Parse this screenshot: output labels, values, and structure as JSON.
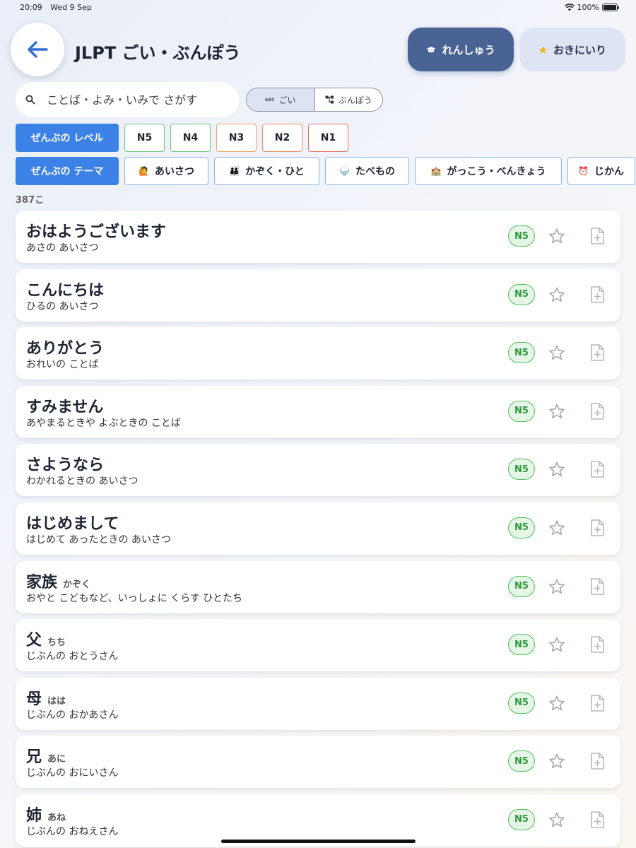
{
  "status_bar": {
    "time": "20:09",
    "date": "Wed 9 Sep",
    "battery": "100%"
  },
  "header": {
    "title": "JLPT ごい・ぶんぽう",
    "practice_label": "れんしゅう",
    "favorites_label": "おきにいり"
  },
  "search": {
    "placeholder": "ことば・よみ・いみで さがす",
    "value": ""
  },
  "segment": {
    "vocab_label": "ごい",
    "grammar_label": "ぶんぽう",
    "selected": "ごい"
  },
  "levels": {
    "all_label": "ぜんぶの レベル",
    "items": [
      "N5",
      "N4",
      "N3",
      "N2",
      "N1"
    ]
  },
  "themes": {
    "all_label": "ぜんぶの テーマ",
    "items": [
      {
        "label": "あいさつ",
        "icon": "🙋"
      },
      {
        "label": "かぞく・ひと",
        "icon": "👪"
      },
      {
        "label": "たべもの",
        "icon": "🍚"
      },
      {
        "label": "がっこう・べんきょう",
        "icon": "🏫"
      },
      {
        "label": "じかん",
        "icon": "⏰"
      }
    ]
  },
  "result_count": "387こ",
  "entries": [
    {
      "word": "おはようございます",
      "reading": "",
      "meaning": "あさの あいさつ",
      "level": "N5"
    },
    {
      "word": "こんにちは",
      "reading": "",
      "meaning": "ひるの あいさつ",
      "level": "N5"
    },
    {
      "word": "ありがとう",
      "reading": "",
      "meaning": "おれいの ことば",
      "level": "N5"
    },
    {
      "word": "すみません",
      "reading": "",
      "meaning": "あやまるときや よぶときの ことば",
      "level": "N5"
    },
    {
      "word": "さようなら",
      "reading": "",
      "meaning": "わかれるときの あいさつ",
      "level": "N5"
    },
    {
      "word": "はじめまして",
      "reading": "",
      "meaning": "はじめて あったときの あいさつ",
      "level": "N5"
    },
    {
      "word": "家族",
      "reading": "かぞく",
      "meaning": "おやと こどもなど、いっしょに くらす ひとたち",
      "level": "N5"
    },
    {
      "word": "父",
      "reading": "ちち",
      "meaning": "じぶんの おとうさん",
      "level": "N5"
    },
    {
      "word": "母",
      "reading": "はは",
      "meaning": "じぶんの おかあさん",
      "level": "N5"
    },
    {
      "word": "兄",
      "reading": "あに",
      "meaning": "じぶんの おにいさん",
      "level": "N5"
    },
    {
      "word": "姉",
      "reading": "あね",
      "meaning": "じぶんの おねえさん",
      "level": "N5"
    }
  ],
  "colors": {
    "primary": "#3c82e6",
    "practice_bg": "#4a6395",
    "favorites_bg": "#dfe4f4",
    "badge_green": "#4fbf5b",
    "level_borders": {
      "N5": "#6cc477",
      "N4": "#6cc477",
      "N3": "#f0a260",
      "N2": "#f08a60",
      "N1": "#ea6f63"
    }
  }
}
